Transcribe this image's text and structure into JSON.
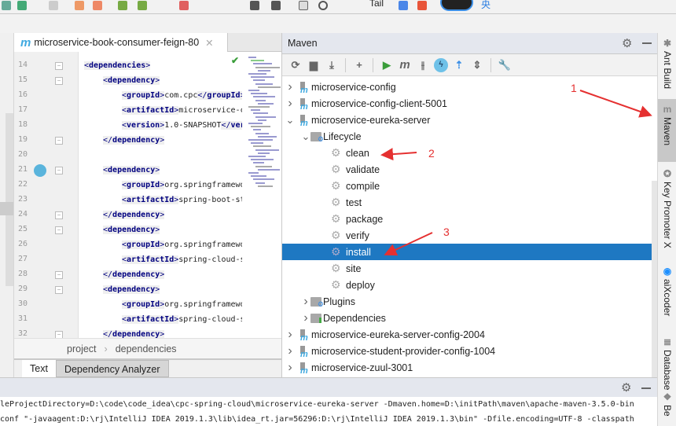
{
  "toolbar": {
    "tail_label": "Tail",
    "ime_label": "央"
  },
  "editor": {
    "file_tab": "microservice-book-consumer-feign-80",
    "lines": [
      {
        "n": "14",
        "indent": 0,
        "kind": "open",
        "tag": "dependencies"
      },
      {
        "n": "15",
        "indent": 1,
        "kind": "open",
        "tag": "dependency"
      },
      {
        "n": "16",
        "indent": 2,
        "kind": "elem",
        "tag": "groupId",
        "text": "com.cpc",
        "close": "groupId"
      },
      {
        "n": "17",
        "indent": 2,
        "kind": "elem",
        "tag": "artifactId",
        "text": "microservice-c"
      },
      {
        "n": "18",
        "indent": 2,
        "kind": "elem",
        "tag": "version",
        "text": "1.0-SNAPSHOT",
        "close": "version"
      },
      {
        "n": "19",
        "indent": 1,
        "kind": "close",
        "tag": "dependency"
      },
      {
        "n": "20",
        "indent": 0,
        "kind": "blank"
      },
      {
        "n": "21",
        "indent": 1,
        "kind": "open",
        "tag": "dependency"
      },
      {
        "n": "22",
        "indent": 2,
        "kind": "elem",
        "tag": "groupId",
        "text": "org.springframewo"
      },
      {
        "n": "23",
        "indent": 2,
        "kind": "elem",
        "tag": "artifactId",
        "text": "spring-boot-st"
      },
      {
        "n": "24",
        "indent": 1,
        "kind": "close",
        "tag": "dependency"
      },
      {
        "n": "25",
        "indent": 1,
        "kind": "open",
        "tag": "dependency"
      },
      {
        "n": "26",
        "indent": 2,
        "kind": "elem",
        "tag": "groupId",
        "text": "org.springframewo"
      },
      {
        "n": "27",
        "indent": 2,
        "kind": "elem",
        "tag": "artifactId",
        "text": "spring-cloud-s"
      },
      {
        "n": "28",
        "indent": 1,
        "kind": "close",
        "tag": "dependency"
      },
      {
        "n": "29",
        "indent": 1,
        "kind": "open",
        "tag": "dependency"
      },
      {
        "n": "30",
        "indent": 2,
        "kind": "elem",
        "tag": "groupId",
        "text": "org.springframewo"
      },
      {
        "n": "31",
        "indent": 2,
        "kind": "elem",
        "tag": "artifactId",
        "text": "spring-cloud-s"
      },
      {
        "n": "32",
        "indent": 1,
        "kind": "close",
        "tag": "dependency"
      }
    ],
    "breadcrumb": [
      "project",
      "dependencies"
    ],
    "bottom_tabs": [
      "Text",
      "Dependency Analyzer"
    ]
  },
  "maven": {
    "title": "Maven",
    "tree": [
      {
        "label": "microservice-config",
        "level": 0,
        "type": "module",
        "state": "collapsed"
      },
      {
        "label": "microservice-config-client-5001",
        "level": 0,
        "type": "module",
        "state": "collapsed"
      },
      {
        "label": "microservice-eureka-server",
        "level": 0,
        "type": "module",
        "state": "expanded"
      },
      {
        "label": "Lifecycle",
        "level": 1,
        "type": "folder",
        "state": "expanded"
      },
      {
        "label": "clean",
        "level": 2,
        "type": "goal"
      },
      {
        "label": "validate",
        "level": 2,
        "type": "goal"
      },
      {
        "label": "compile",
        "level": 2,
        "type": "goal"
      },
      {
        "label": "test",
        "level": 2,
        "type": "goal"
      },
      {
        "label": "package",
        "level": 2,
        "type": "goal"
      },
      {
        "label": "verify",
        "level": 2,
        "type": "goal"
      },
      {
        "label": "install",
        "level": 2,
        "type": "goal",
        "selected": true
      },
      {
        "label": "site",
        "level": 2,
        "type": "goal"
      },
      {
        "label": "deploy",
        "level": 2,
        "type": "goal"
      },
      {
        "label": "Plugins",
        "level": 1,
        "type": "folder",
        "state": "collapsed"
      },
      {
        "label": "Dependencies",
        "level": 1,
        "type": "deps",
        "state": "collapsed"
      },
      {
        "label": "microservice-eureka-server-config-2004",
        "level": 0,
        "type": "module",
        "state": "collapsed"
      },
      {
        "label": "microservice-student-provider-config-1004",
        "level": 0,
        "type": "module",
        "state": "collapsed"
      },
      {
        "label": "microservice-zuul-3001",
        "level": 0,
        "type": "module",
        "state": "collapsed"
      }
    ],
    "selected_color": "#1e78c2"
  },
  "console": {
    "lines": [
      "leProjectDirectory=D:\\code\\code_idea\\cpc-spring-cloud\\microservice-eureka-server -Dmaven.home=D:\\initPath\\maven\\apache-maven-3.5.0-bin",
      "conf \"-javaagent:D:\\rj\\IntelliJ IDEA 2019.1.3\\lib\\idea_rt.jar=56296:D:\\rj\\IntelliJ IDEA 2019.1.3\\bin\" -Dfile.encoding=UTF-8 -classpath"
    ]
  },
  "right_tools": [
    {
      "label": "Ant Build",
      "icon": "ant-icon"
    },
    {
      "label": "Maven",
      "icon": "maven-icon",
      "active": true
    },
    {
      "label": "Key Promoter X",
      "icon": "key-promoter-icon"
    },
    {
      "label": "aiXcoder",
      "icon": "aixcoder-icon"
    },
    {
      "label": "Database",
      "icon": "database-icon"
    },
    {
      "label": "Be",
      "icon": "bean-icon"
    }
  ],
  "annotations": [
    "1",
    "2",
    "3"
  ],
  "annotation_color": "#e53030"
}
